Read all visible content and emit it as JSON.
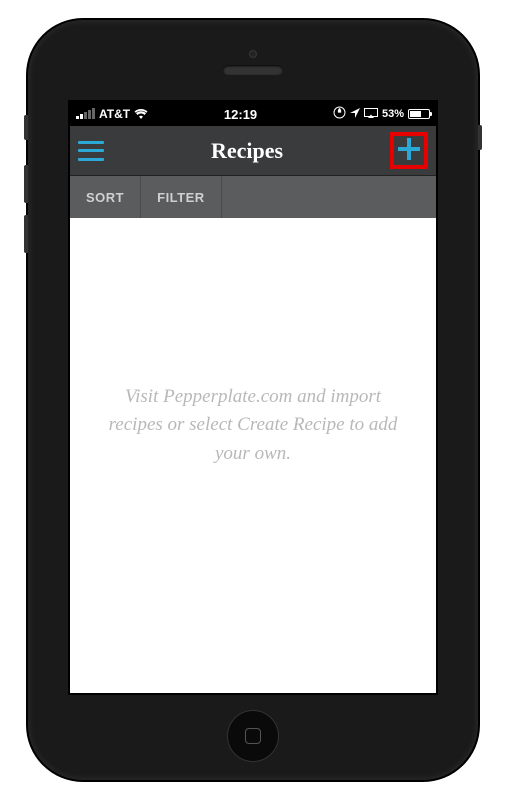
{
  "status_bar": {
    "carrier": "AT&T",
    "time": "12:19",
    "battery_percent": "53%"
  },
  "nav": {
    "title": "Recipes"
  },
  "sub_bar": {
    "sort": "SORT",
    "filter": "FILTER"
  },
  "content": {
    "empty_message": "Visit Pepperplate.com and import recipes or select Create Recipe to add your own."
  }
}
